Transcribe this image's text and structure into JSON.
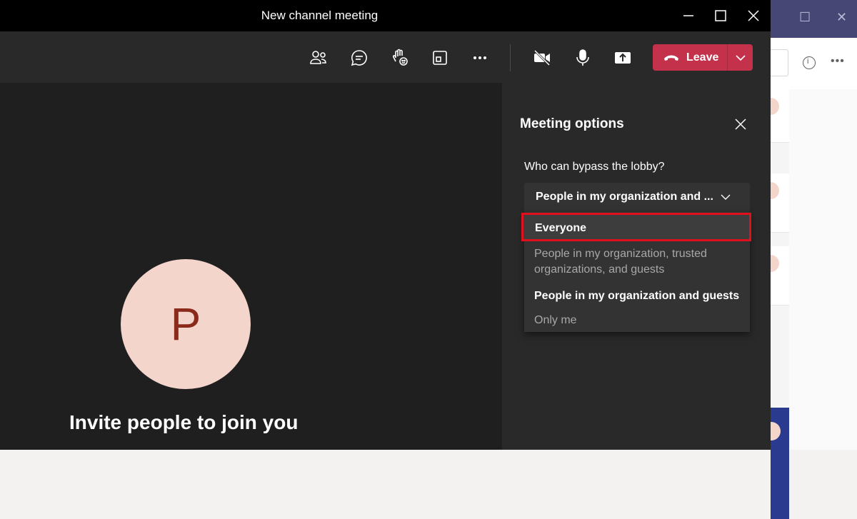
{
  "window": {
    "title": "New channel meeting"
  },
  "toolbar": {
    "leave_label": "Leave",
    "leave_color": "#c4314b",
    "icons": [
      "participants-icon",
      "chat-icon",
      "raise-hand-icon",
      "room-view-icon",
      "more-icon",
      "camera-off-icon",
      "mic-icon",
      "share-icon"
    ]
  },
  "stage": {
    "avatar_initial": "P",
    "invite_text": "Invite people to join you"
  },
  "meeting_options": {
    "title": "Meeting options",
    "lobby_label": "Who can bypass the lobby?",
    "selected_value": "People in my organization and ...",
    "options": [
      {
        "label": "Everyone",
        "highlighted": true
      },
      {
        "label": "People in my organization, trusted organizations, and guests",
        "line1": "People in my organization, trusted",
        "line2": "organizations, and guests"
      },
      {
        "label": "People in my organization and guests",
        "current": true
      },
      {
        "label": "Only me"
      }
    ]
  }
}
